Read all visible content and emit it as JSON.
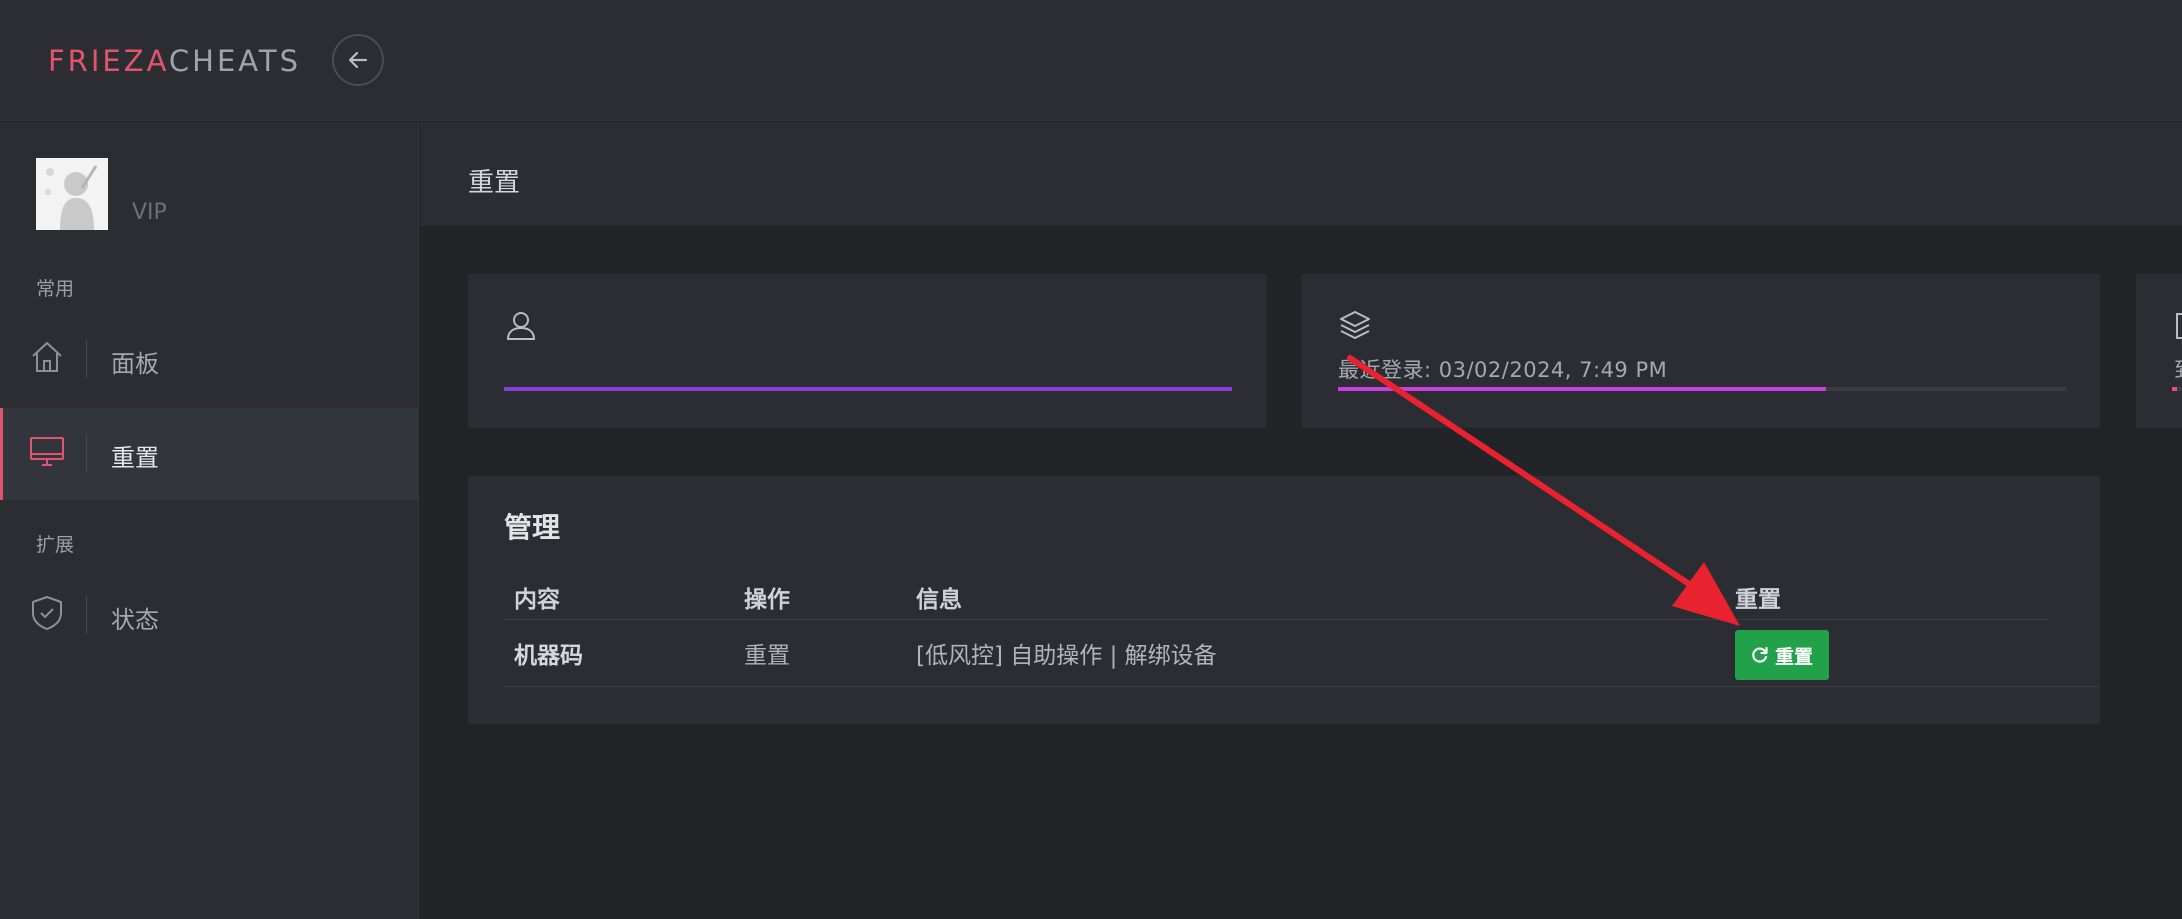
{
  "brand": {
    "part1": "FRIEZA",
    "part2": "CHEATS",
    "accent": "#e2546b"
  },
  "sidebar": {
    "user": {
      "role": "VIP"
    },
    "sections": [
      {
        "label": "常用"
      },
      {
        "label": "扩展"
      }
    ],
    "items": [
      {
        "label": "面板",
        "icon": "home-icon",
        "active": false
      },
      {
        "label": "重置",
        "icon": "monitor-icon",
        "active": true
      },
      {
        "label": "状态",
        "icon": "shield-check-icon",
        "active": false
      }
    ]
  },
  "page": {
    "title": "重置"
  },
  "cards": [
    {
      "icon": "user-icon",
      "text": "",
      "progress": 1.0,
      "color": "#8a3fd8"
    },
    {
      "icon": "layers-icon",
      "text": "最近登录: 03/02/2024, 7:49 PM",
      "progress": 0.67,
      "color": "#c83fe0"
    },
    {
      "icon": "calendar-icon",
      "text": "到",
      "progress": 0.5,
      "color": "#e2546b"
    }
  ],
  "panel": {
    "title": "管理",
    "columns": [
      "内容",
      "操作",
      "信息",
      "重置"
    ],
    "rows": [
      {
        "content": "机器码",
        "action": "重置",
        "info": "[低风控] 自助操作 | 解绑设备",
        "button_label": "重置"
      }
    ]
  },
  "colors": {
    "button_green": "#21a14a",
    "annotation_red": "#e8232f"
  }
}
